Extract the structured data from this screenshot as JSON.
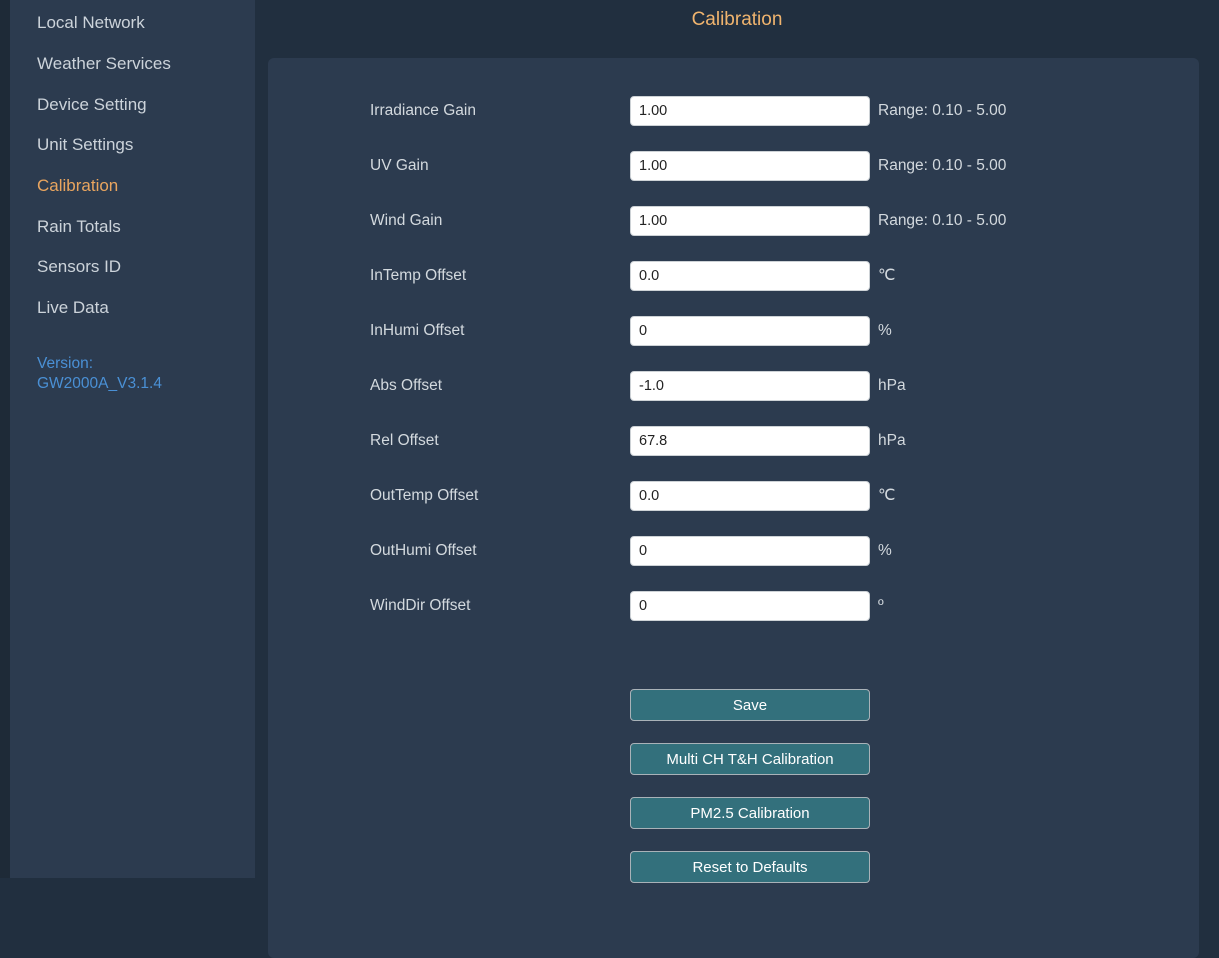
{
  "header": {
    "title": "Calibration"
  },
  "sidebar": {
    "items": [
      {
        "label": "Local Network",
        "active": false
      },
      {
        "label": "Weather Services",
        "active": false
      },
      {
        "label": "Device Setting",
        "active": false
      },
      {
        "label": "Unit Settings",
        "active": false
      },
      {
        "label": "Calibration",
        "active": true
      },
      {
        "label": "Rain Totals",
        "active": false
      },
      {
        "label": "Sensors ID",
        "active": false
      },
      {
        "label": "Live Data",
        "active": false
      }
    ],
    "version_line1": "Version:",
    "version_line2": "GW2000A_V3.1.4"
  },
  "form": {
    "rows": [
      {
        "label": "Irradiance Gain",
        "value": "1.00",
        "suffix": "Range: 0.10 - 5.00"
      },
      {
        "label": "UV Gain",
        "value": "1.00",
        "suffix": "Range: 0.10 - 5.00"
      },
      {
        "label": "Wind Gain",
        "value": "1.00",
        "suffix": "Range: 0.10 - 5.00"
      },
      {
        "label": "InTemp Offset",
        "value": "0.0",
        "suffix": "℃"
      },
      {
        "label": "InHumi Offset",
        "value": "0",
        "suffix": "%"
      },
      {
        "label": "Abs Offset",
        "value": "-1.0",
        "suffix": "hPa"
      },
      {
        "label": "Rel Offset",
        "value": "67.8",
        "suffix": "hPa"
      },
      {
        "label": "OutTemp Offset",
        "value": "0.0",
        "suffix": "℃"
      },
      {
        "label": "OutHumi Offset",
        "value": "0",
        "suffix": "%"
      },
      {
        "label": "WindDir Offset",
        "value": "0",
        "suffix": "º"
      }
    ],
    "buttons": [
      "Save",
      "Multi CH T&H Calibration",
      "PM2.5 Calibration",
      "Reset to Defaults"
    ]
  },
  "colors": {
    "sidebar_bg": "#2c3b4f",
    "panel_bg": "#2c3b4f",
    "page_bg": "#212f3f",
    "left_strip_bg": "#1e2a37",
    "accent_orange": "#f0b46e",
    "active_item_orange": "#e9a55f",
    "version_blue": "#4a90d5",
    "button_teal": "#33707c",
    "text_light": "#d3d9de"
  }
}
